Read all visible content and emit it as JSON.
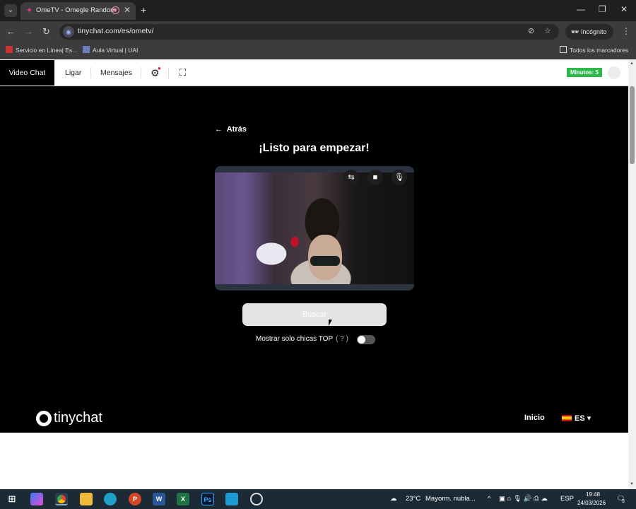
{
  "browser": {
    "tab_title": "OmeTV - Omegle Random",
    "url": "tinychat.com/es/ometv/",
    "profile": "Incógnito",
    "bookmarks": [
      "Servicio en Línea| Es...",
      "Aula Virtual | UAI"
    ],
    "all_bookmarks": "Todos los marcadores"
  },
  "site_nav": {
    "items": [
      "Video Chat",
      "Ligar",
      "Mensajes"
    ],
    "minutes": "Minutos: 5"
  },
  "main": {
    "back": "Atrás",
    "title": "¡Listo para empezar!",
    "search_button": "Buscar",
    "toggle_label": "Mostrar solo chicas TOP",
    "toggle_help": "( ? )",
    "toggle_on": false
  },
  "footer": {
    "logo": "tinychat",
    "home": "Inicio",
    "language": "ES"
  },
  "taskbar": {
    "weather": "23°C",
    "weather_desc": "Mayorm. nubla...",
    "lang": "ESP",
    "time": "19:48",
    "date": "24/03/2026",
    "notifications": "3"
  },
  "colors": {
    "minutes_badge": "#2db84a",
    "page_bg": "#000000",
    "taskbar": "#1c2a36"
  }
}
